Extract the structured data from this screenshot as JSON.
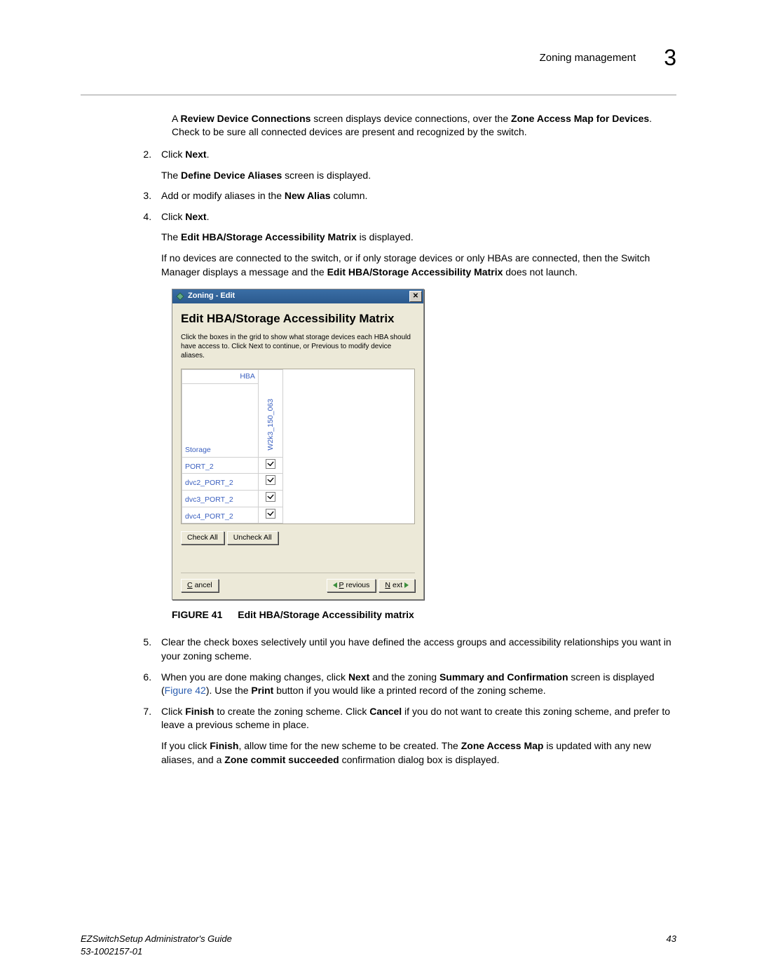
{
  "header": {
    "section": "Zoning management",
    "chapter": "3"
  },
  "intro": {
    "line1a": "A ",
    "line1b": "Review Device Connections",
    "line1c": " screen displays device connections, over the ",
    "line1d": "Zone Access Map for Devices",
    "line1e": ". Check to be sure all connected devices are present and recognized by the switch."
  },
  "steps_top": {
    "s2": {
      "a": "Click ",
      "b": "Next",
      "c": ".",
      "sub_a": "The ",
      "sub_b": "Define Device Aliases",
      "sub_c": " screen is displayed."
    },
    "s3": {
      "a": "Add or modify aliases in the ",
      "b": "New Alias",
      "c": " column."
    },
    "s4": {
      "a": "Click ",
      "b": "Next",
      "c": ".",
      "sub1_a": "The ",
      "sub1_b": "Edit HBA/Storage Accessibility Matrix",
      "sub1_c": " is displayed.",
      "sub2_a": "If no devices are connected to the switch, or if only storage devices or only HBAs are connected, then the Switch Manager displays a message and the ",
      "sub2_b": "Edit HBA/Storage Accessibility Matrix",
      "sub2_c": " does not launch."
    }
  },
  "dialog": {
    "title": "Zoning - Edit",
    "heading": "Edit HBA/Storage Accessibility Matrix",
    "desc": "Click the boxes in the grid to show what storage devices each HBA should have access to. Click Next to continue, or Previous to modify device aliases.",
    "hba_label": "HBA",
    "hba_col": "W2k3_150_063",
    "storage_label": "Storage",
    "rows": {
      "r0": "PORT_2",
      "r1": "dvc2_PORT_2",
      "r2": "dvc3_PORT_2",
      "r3": "dvc4_PORT_2"
    },
    "check_all": "Check All",
    "uncheck_all": "Uncheck All",
    "cancel": "ancel",
    "cancel_u": "C",
    "previous": "revious",
    "previous_u": "P",
    "next": "ext",
    "next_u": "N"
  },
  "figure": {
    "label": "FIGURE 41",
    "caption": "Edit HBA/Storage Accessibility matrix"
  },
  "steps_bottom": {
    "s5": "Clear the check boxes selectively until you have defined the access groups and accessibility relationships you want in your zoning scheme.",
    "s6": {
      "a": "When you are done making changes, click ",
      "b": "Next",
      "c": " and the zoning ",
      "d": "Summary and Confirmation",
      "e": " screen is displayed (",
      "link": "Figure 42",
      "f": "). Use the ",
      "g": "Print",
      "h": " button if you would like a printed record of the zoning scheme."
    },
    "s7": {
      "a": "Click ",
      "b": "Finish",
      "c": " to create the zoning scheme. Click ",
      "d": "Cancel",
      "e": " if you do not want to create this zoning scheme, and prefer to leave a previous scheme in place.",
      "sub_a": "If you click ",
      "sub_b": "Finish",
      "sub_c": ", allow time for the new scheme to be created. The ",
      "sub_d": "Zone Access Map",
      "sub_e": " is updated with any new aliases, and a ",
      "sub_f": "Zone commit succeeded",
      "sub_g": " confirmation dialog box is displayed."
    }
  },
  "footer": {
    "guide": "EZSwitchSetup Administrator's Guide",
    "docnum": "53-1002157-01",
    "page": "43"
  }
}
